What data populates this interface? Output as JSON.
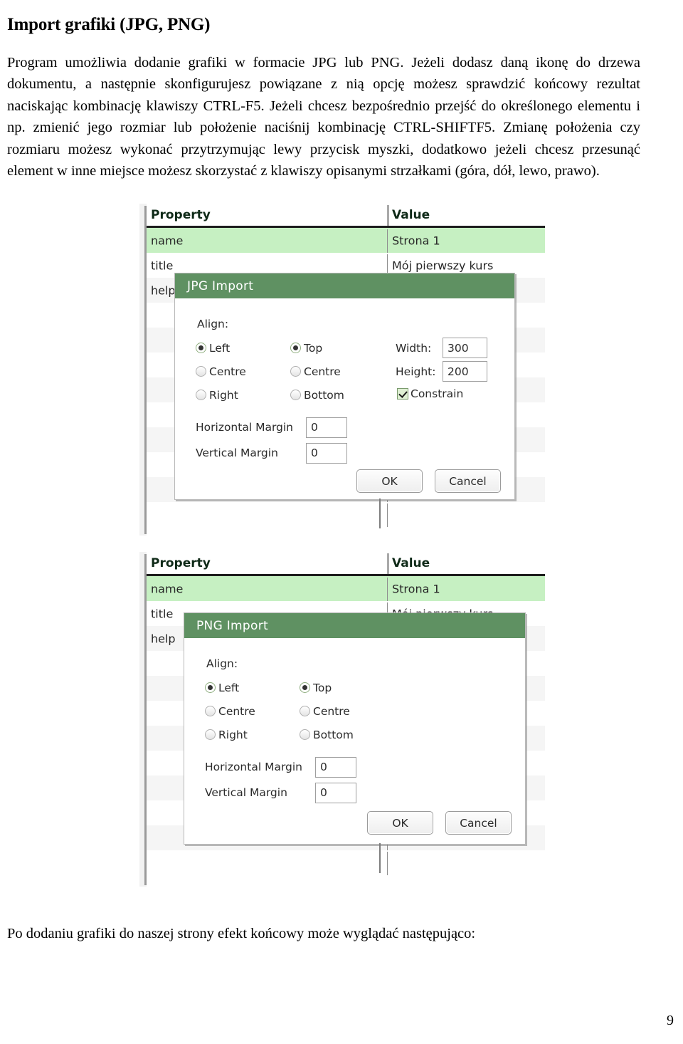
{
  "document": {
    "title": "Import grafiki (JPG, PNG)",
    "paragraph": "Program umożliwia dodanie grafiki w formacie JPG lub PNG. Jeżeli dodasz daną ikonę do drzewa dokumentu, a następnie skonfigurujesz powiązane z nią opcję możesz sprawdzić końcowy rezultat naciskając kombinację klawiszy CTRL-F5. Jeżeli chcesz bezpośrednio przejść do określonego elementu i np. zmienić jego rozmiar lub położenie naciśnij kombinację  CTRL-SHIFTF5. Zmianę położenia czy rozmiaru możesz wykonać przytrzymując lewy przycisk myszki, dodatkowo jeżeli chcesz przesunąć element w inne miejsce możesz skorzystać z klawiszy opisanymi strzałkami (góra, dół, lewo, prawo).",
    "closing_paragraph": "Po dodaniu grafiki do naszej strony efekt końcowy może wyglądać następująco:",
    "page_number": "9"
  },
  "property_table": {
    "columns": [
      "Property",
      "Value"
    ],
    "rows": [
      {
        "property": "name",
        "value": "Strona 1",
        "state": "selected"
      },
      {
        "property": "title",
        "value": "Mój pierwszy kurs",
        "state": "normal"
      },
      {
        "property": "help",
        "value": "",
        "state": "stripe"
      },
      {
        "property": "",
        "value": "",
        "state": "normal"
      },
      {
        "property": "",
        "value": "",
        "state": "stripe"
      },
      {
        "property": "",
        "value": "",
        "state": "normal"
      },
      {
        "property": "",
        "value": "",
        "state": "stripe"
      },
      {
        "property": "",
        "value": "",
        "state": "normal"
      },
      {
        "property": "",
        "value": "",
        "state": "stripe"
      },
      {
        "property": "",
        "value": "",
        "state": "normal"
      },
      {
        "property": "",
        "value": "",
        "state": "stripe"
      },
      {
        "property": "",
        "value": "",
        "state": "normal"
      },
      {
        "property": "",
        "value": "",
        "state": "stripe"
      }
    ]
  },
  "jpg_dialog": {
    "title": "JPG Import",
    "align_label": "Align:",
    "horizontal_align": [
      {
        "label": "Left",
        "selected": true
      },
      {
        "label": "Centre",
        "selected": false
      },
      {
        "label": "Right",
        "selected": false
      }
    ],
    "vertical_align": [
      {
        "label": "Top",
        "selected": true
      },
      {
        "label": "Centre",
        "selected": false
      },
      {
        "label": "Bottom",
        "selected": false
      }
    ],
    "width_label": "Width:",
    "width_value": "300",
    "height_label": "Height:",
    "height_value": "200",
    "constrain_label": "Constrain",
    "constrain_checked": true,
    "horizontal_margin_label": "Horizontal Margin",
    "horizontal_margin_value": "0",
    "vertical_margin_label": "Vertical Margin",
    "vertical_margin_value": "0",
    "ok_label": "OK",
    "cancel_label": "Cancel"
  },
  "png_dialog": {
    "title": "PNG Import",
    "align_label": "Align:",
    "horizontal_align": [
      {
        "label": "Left",
        "selected": true
      },
      {
        "label": "Centre",
        "selected": false
      },
      {
        "label": "Right",
        "selected": false
      }
    ],
    "vertical_align": [
      {
        "label": "Top",
        "selected": true
      },
      {
        "label": "Centre",
        "selected": false
      },
      {
        "label": "Bottom",
        "selected": false
      }
    ],
    "horizontal_margin_label": "Horizontal Margin",
    "horizontal_margin_value": "0",
    "vertical_margin_label": "Vertical Margin",
    "vertical_margin_value": "0",
    "ok_label": "OK",
    "cancel_label": "Cancel"
  },
  "colors": {
    "dialog_title_green": "#5f9162",
    "selected_row_green": "#c6f0c2",
    "stripe_grey": "#f5f5f5",
    "border_grey": "#b9b9b9"
  }
}
